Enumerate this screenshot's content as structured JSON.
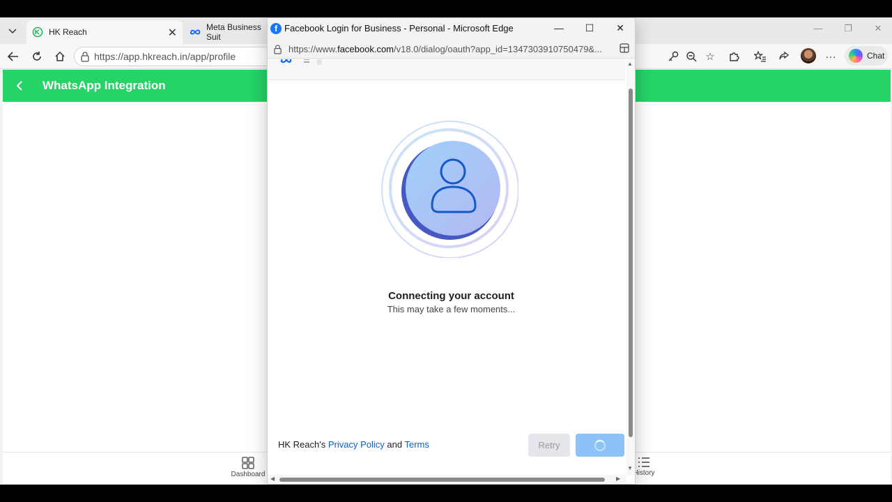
{
  "browser": {
    "tabs": [
      {
        "label": "HK Reach",
        "active": true
      },
      {
        "label": "Meta Business Suit",
        "active": false
      }
    ],
    "address": "https://app.hkreach.in/app/profile",
    "chat_label": "Chat"
  },
  "app": {
    "header_title": "WhatsApp Integration",
    "accent_color": "#25d366",
    "nav": {
      "dashboard": "Dashboard",
      "history": "History"
    }
  },
  "popup": {
    "window_title": "Facebook Login for Business - Personal - Microsoft Edge",
    "url_prefix": "https://www.",
    "url_domain": "facebook.com",
    "url_rest": "/v18.0/dialog/oauth?app_id=1347303910750479&...",
    "status_title": "Connecting your account",
    "status_subtitle": "This may take a few moments...",
    "footer": {
      "owner": "HK Reach's",
      "privacy_link": "Privacy Policy",
      "conjunction": "and",
      "terms_link": "Terms"
    },
    "retry_label": "Retry",
    "brand_color": "#1877f2"
  }
}
